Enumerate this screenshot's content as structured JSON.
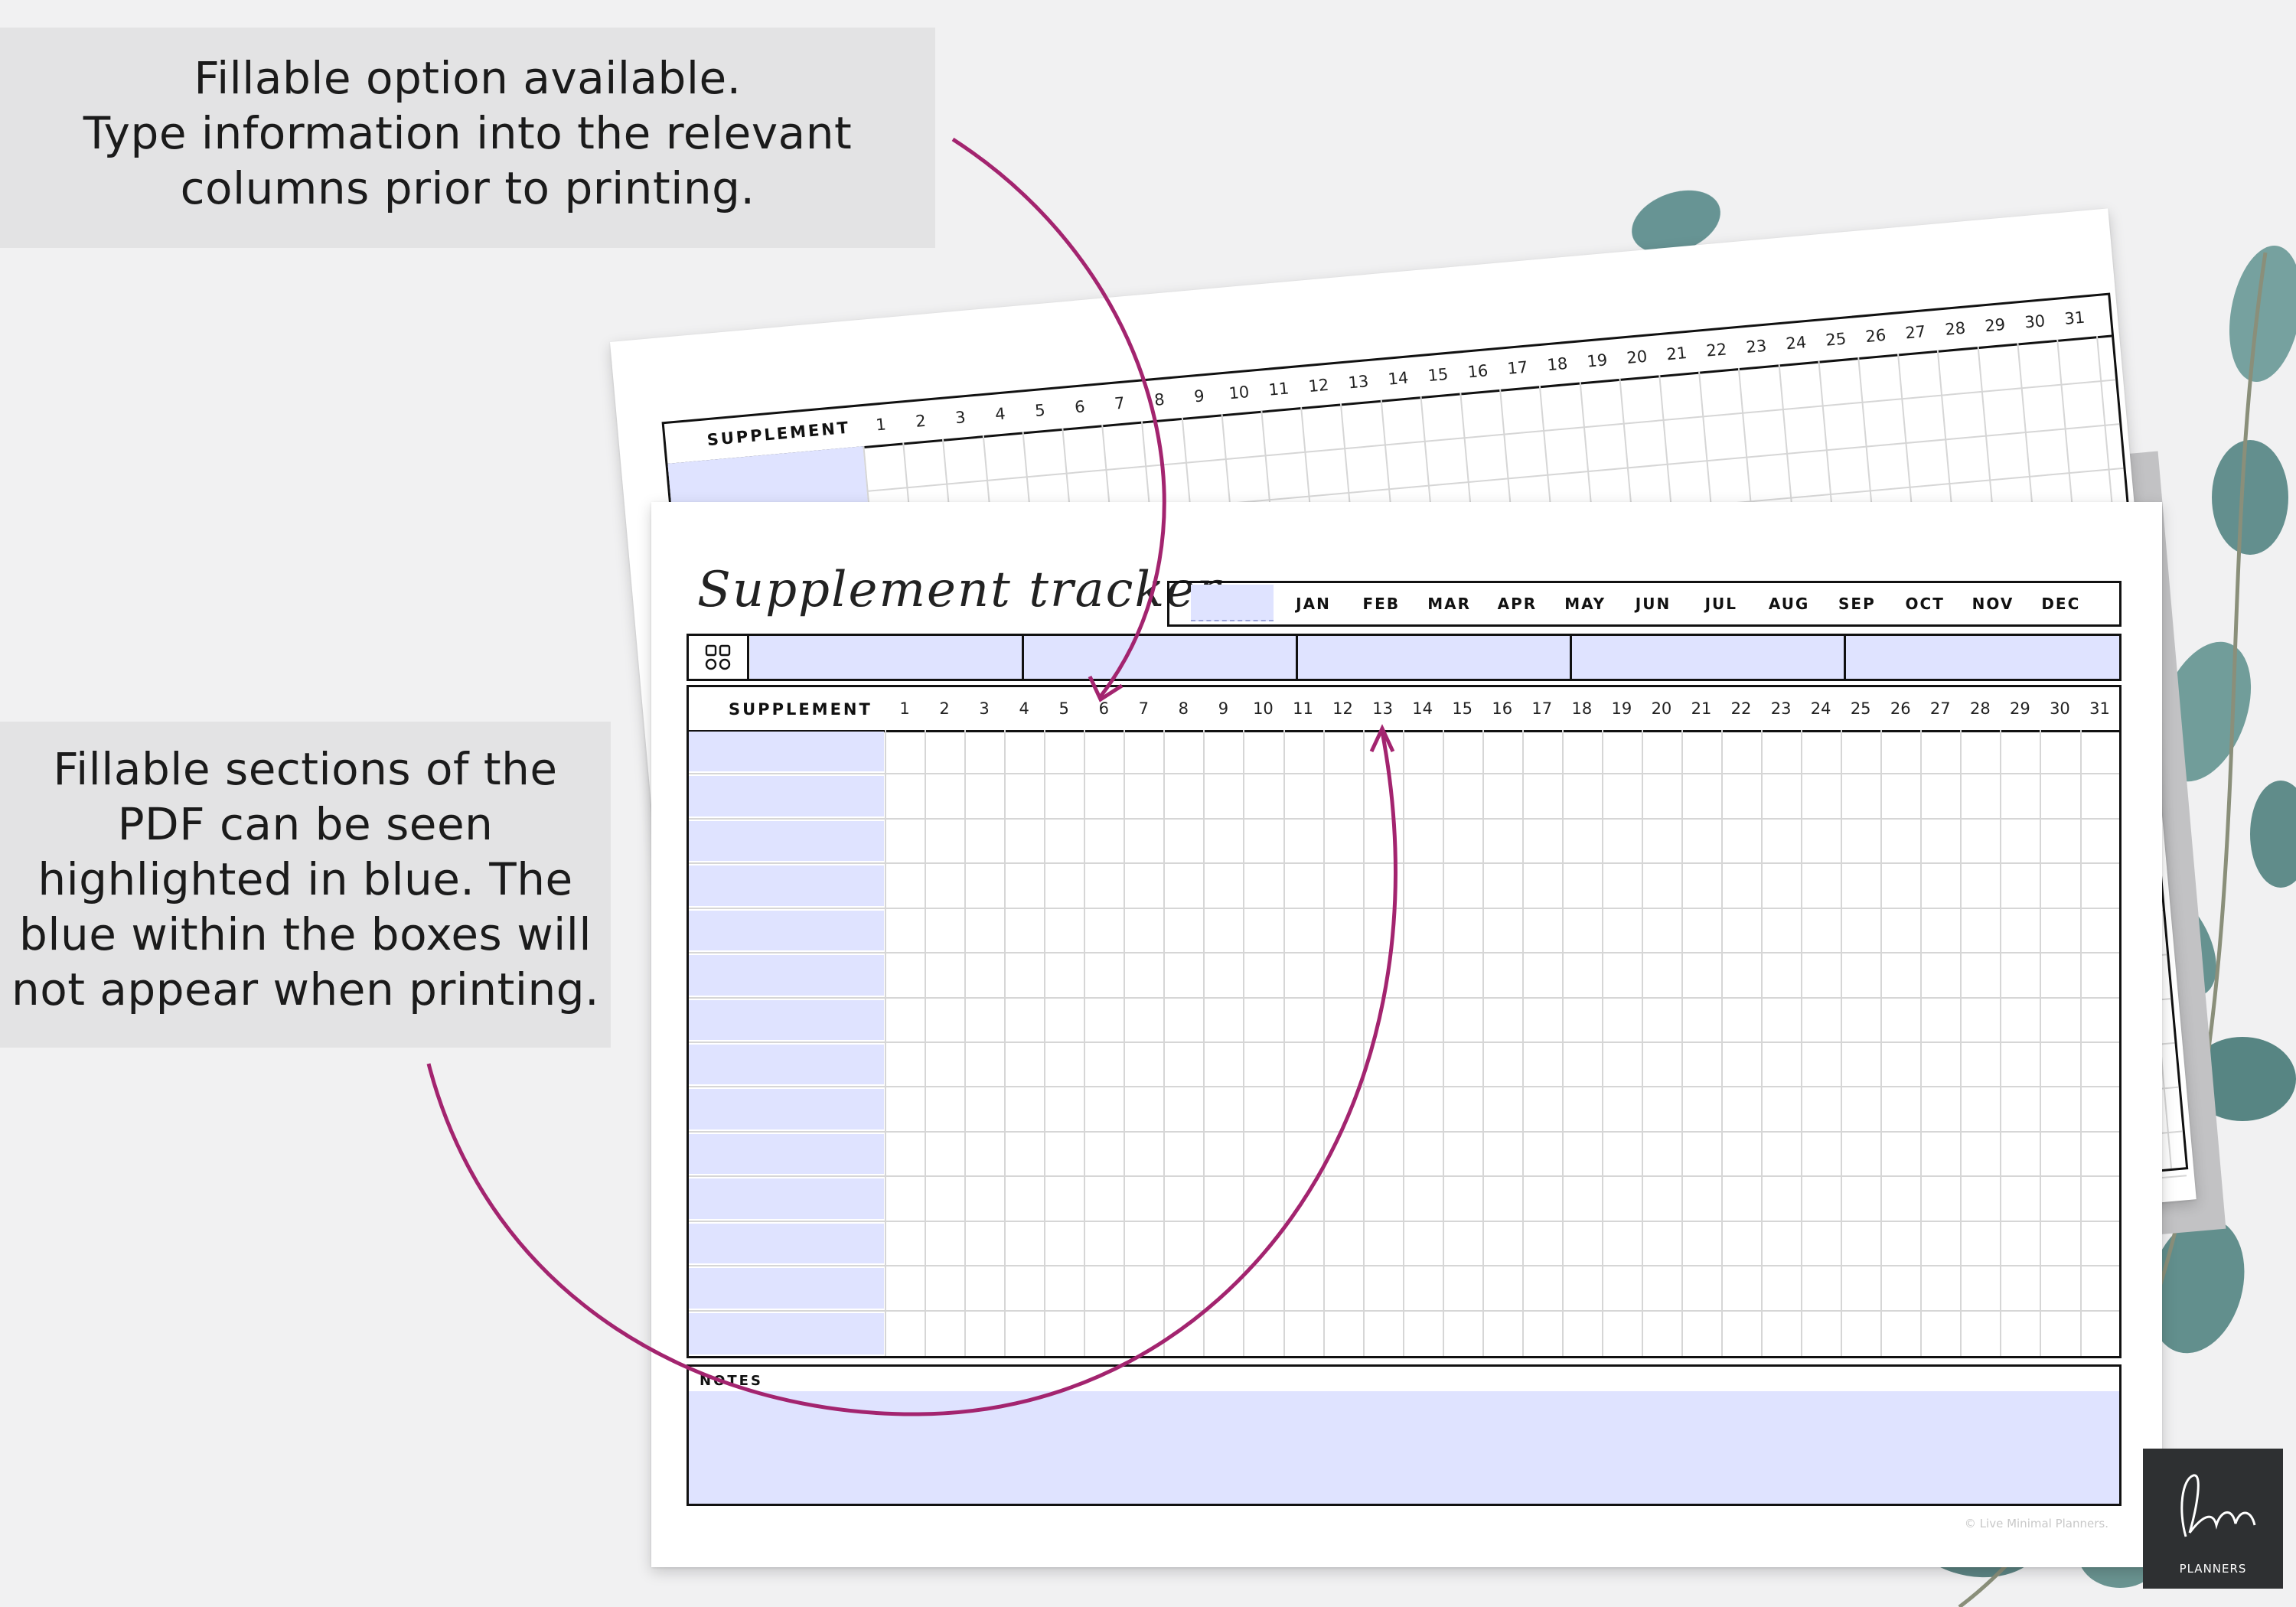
{
  "callouts": {
    "top": [
      "Fillable option available.",
      "Type information into the relevant",
      "columns prior to printing."
    ],
    "bottom": [
      "Fillable sections of the",
      "PDF can be seen",
      "highlighted in blue. The",
      "blue within the boxes will",
      "not appear when printing."
    ]
  },
  "back_sheet": {
    "supplement_label": "SUPPLEMENT",
    "days": [
      "1",
      "2",
      "3",
      "4",
      "5",
      "6",
      "7",
      "8",
      "9",
      "10",
      "11",
      "12",
      "13",
      "14",
      "15",
      "16",
      "17",
      "18",
      "19",
      "20",
      "21",
      "22",
      "23",
      "24",
      "25",
      "26",
      "27",
      "28",
      "29",
      "30",
      "31"
    ]
  },
  "tracker": {
    "title": "Supplement tracker",
    "months": [
      "JAN",
      "FEB",
      "MAR",
      "APR",
      "MAY",
      "JUN",
      "JUL",
      "AUG",
      "SEP",
      "OCT",
      "NOV",
      "DEC"
    ],
    "supplement_label": "SUPPLEMENT",
    "days": [
      "1",
      "2",
      "3",
      "4",
      "5",
      "6",
      "7",
      "8",
      "9",
      "10",
      "11",
      "12",
      "13",
      "14",
      "15",
      "16",
      "17",
      "18",
      "19",
      "20",
      "21",
      "22",
      "23",
      "24",
      "25",
      "26",
      "27",
      "28",
      "29",
      "30",
      "31"
    ],
    "row_count": 14,
    "notes_label": "NOTES",
    "copyright": "© Live Minimal Planners."
  },
  "brand": {
    "logo_text": "PLANNERS"
  },
  "colors": {
    "fillable": "#dfe3ff",
    "arrow": "#a3246f",
    "logo_bg": "#2e3032"
  }
}
